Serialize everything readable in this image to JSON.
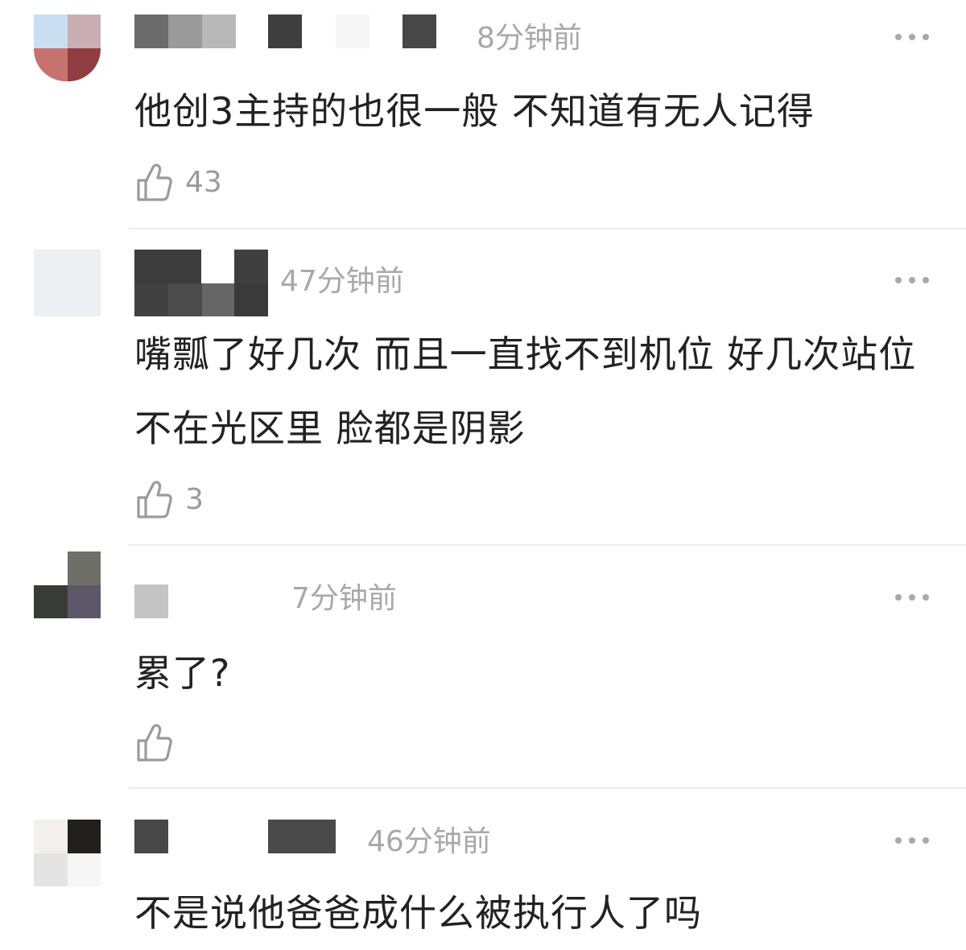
{
  "comments": [
    {
      "time": "8分钟前",
      "text": "他创3主持的也很一般 不知道有无人记得",
      "likes": "43"
    },
    {
      "time": "47分钟前",
      "text": "嘴瓢了好几次 而且一直找不到机位 好几次站位不在光区里 脸都是阴影",
      "likes": "3"
    },
    {
      "time": "7分钟前",
      "text": "累了?",
      "likes": ""
    },
    {
      "time": "46分钟前",
      "text": "不是说他爸爸成什么被执行人了吗",
      "likes": ""
    }
  ],
  "icons": {
    "like": "thumbs-up-outline-icon",
    "more": "more-dots-icon"
  },
  "colors": {
    "text": "#222222",
    "meta": "#a8a8a8",
    "divider": "#ececec",
    "icon": "#9b9b9b"
  }
}
